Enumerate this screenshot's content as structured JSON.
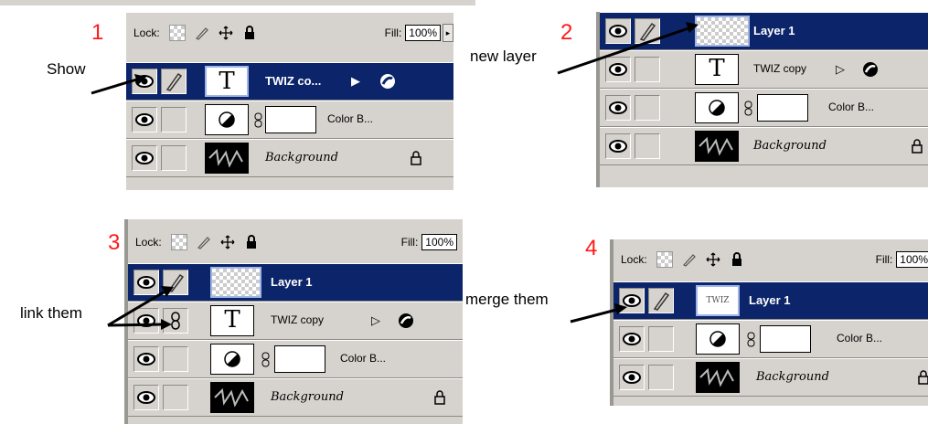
{
  "steps": {
    "s1": {
      "number": "1",
      "label": "Show"
    },
    "s2": {
      "number": "2",
      "label": "new layer"
    },
    "s3": {
      "number": "3",
      "label": "link them"
    },
    "s4": {
      "number": "4",
      "label": "merge them"
    }
  },
  "lockbar": {
    "lock_label": "Lock:",
    "fill_label": "Fill:",
    "fill_value": "100%",
    "fill_value_short": "100%"
  },
  "layers": {
    "layer1": "Layer 1",
    "twiz_copy": "TWIZ copy",
    "twiz_copy_trunc": "TWIZ co...",
    "color_b": "Color B...",
    "background": "Background",
    "type_glyph": "T",
    "merged_thumb_text": "TWIZ"
  },
  "colors": {
    "selected_row": "#0b246a",
    "panel_bg": "#d6d3ce",
    "step_number": "#ff1a1a"
  }
}
